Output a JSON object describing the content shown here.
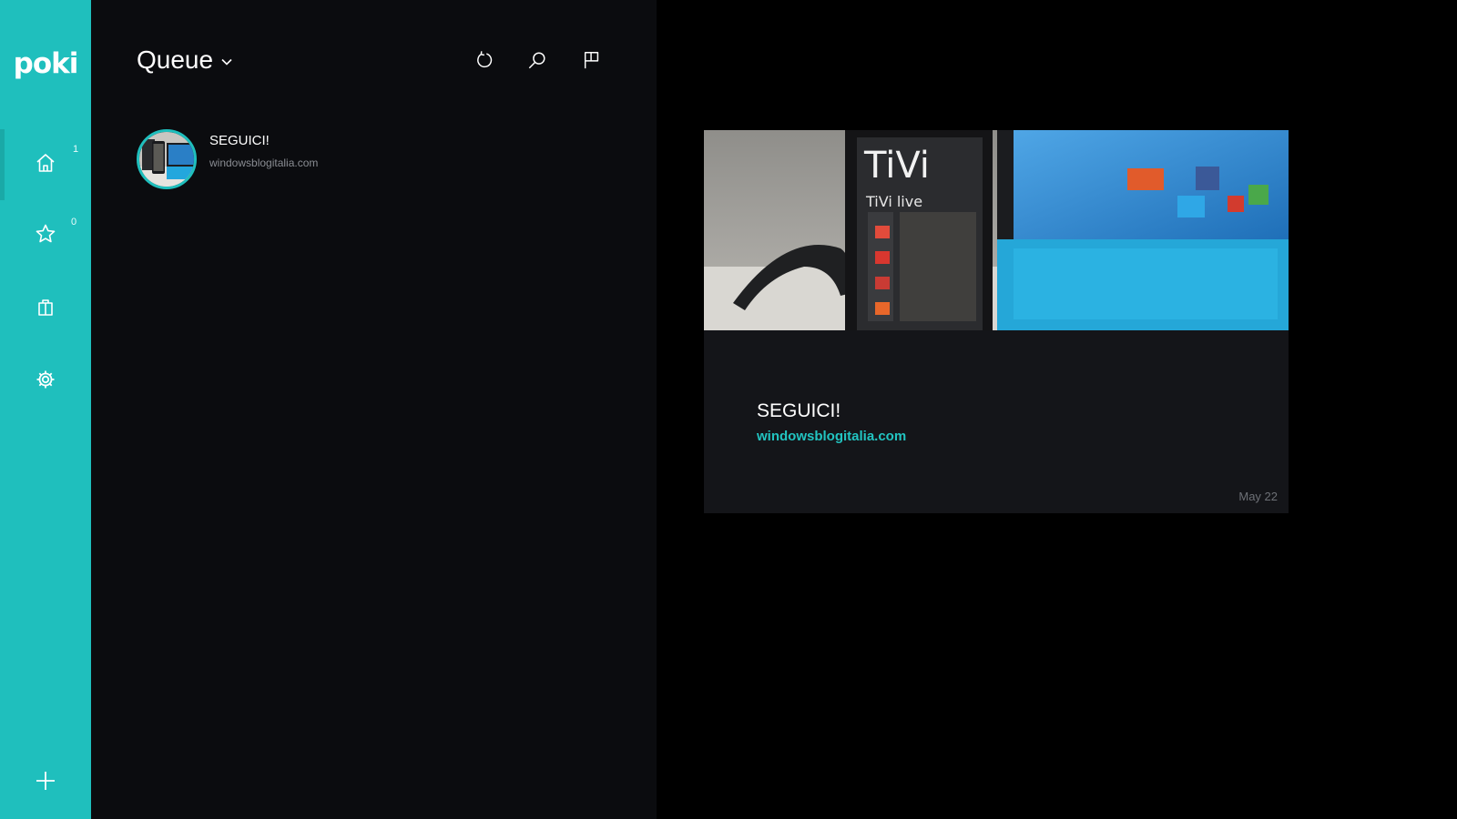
{
  "app": {
    "logo": "poki"
  },
  "sidebar": {
    "items": [
      {
        "id": "home",
        "icon": "home-icon",
        "count": "1",
        "active": true
      },
      {
        "id": "favorites",
        "icon": "star-icon",
        "count": "0",
        "active": false
      },
      {
        "id": "archive",
        "icon": "bag-icon",
        "count": "",
        "active": false
      },
      {
        "id": "settings",
        "icon": "gear-icon",
        "count": "",
        "active": false
      }
    ],
    "add_icon": "plus-icon"
  },
  "list": {
    "title": "Queue",
    "toolbar": [
      "refresh-icon",
      "search-icon",
      "flag-icon"
    ],
    "articles": [
      {
        "title": "SEGUICI!",
        "source": "windowsblogitalia.com"
      }
    ]
  },
  "reader": {
    "title": "SEGUICI!",
    "link": "windowsblogitalia.com",
    "date": "May 22"
  },
  "colors": {
    "accent": "#1fbfbd",
    "list_bg": "#0b0c0f",
    "reader_bg": "#000000",
    "card_bg": "#141519",
    "link": "#22c4c1"
  }
}
